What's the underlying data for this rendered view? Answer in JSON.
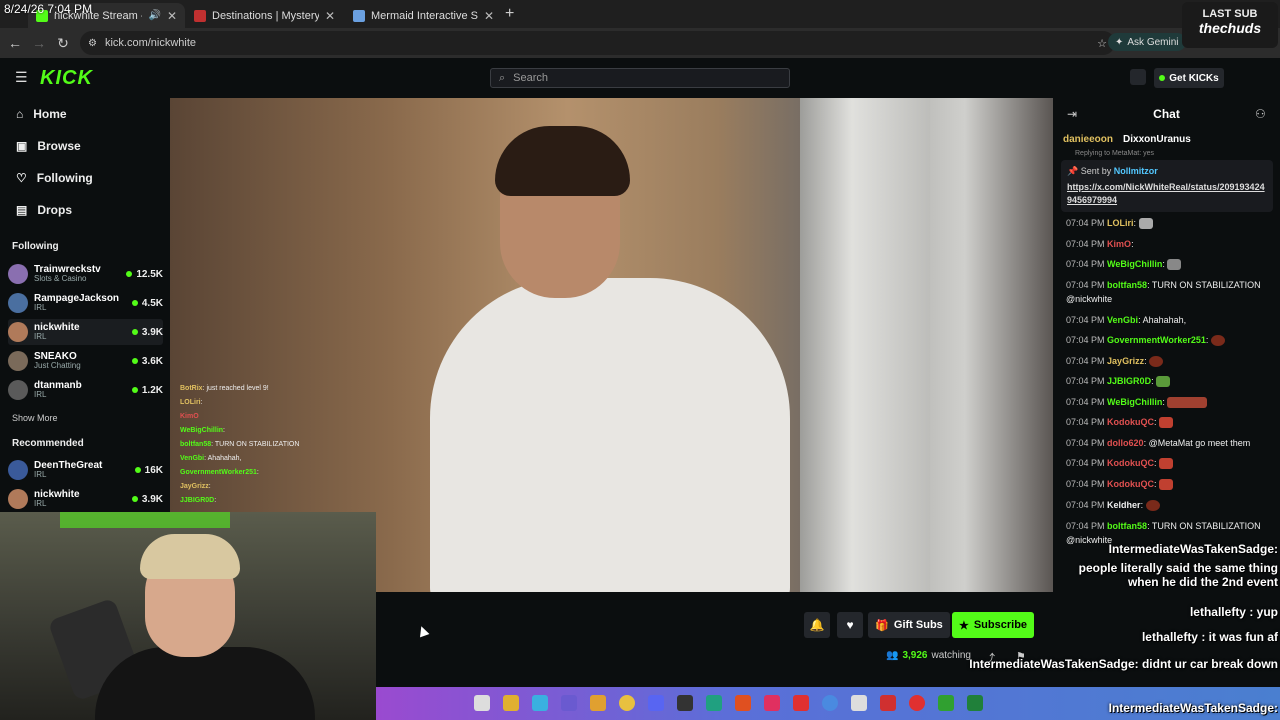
{
  "colors": {
    "accent": "#53fc18",
    "background": "#0b0e0f",
    "panel": "#24272c"
  },
  "overlay": {
    "clock": "8/24/26 7:04 PM",
    "last_sub_label": "LAST SUB",
    "last_sub_name": "thechuds"
  },
  "browser": {
    "tabs": [
      {
        "title": "nickwhite Stream - Watch L",
        "icon": "kick-favicon-icon",
        "active": true
      },
      {
        "title": "Destinations | Mystery Vacation",
        "icon": "destinations-favicon-icon",
        "active": false
      },
      {
        "title": "Mermaid Interactive Spotting M",
        "icon": "mermaid-favicon-icon",
        "active": false
      }
    ],
    "url": "kick.com/nickwhite",
    "gemini_label": "Ask Gemini"
  },
  "kick": {
    "logo": "KICK",
    "search_placeholder": "Search",
    "get_kicks_label": "Get KICKs"
  },
  "sidebar": {
    "nav": [
      {
        "label": "Home",
        "icon": "home-icon"
      },
      {
        "label": "Browse",
        "icon": "browse-icon"
      },
      {
        "label": "Following",
        "icon": "heart-icon"
      },
      {
        "label": "Drops",
        "icon": "drops-icon"
      }
    ],
    "following_heading": "Following",
    "following": [
      {
        "name": "Trainwreckstv",
        "category": "Slots & Casino",
        "viewers": "12.5K",
        "color": "#8a6fb0"
      },
      {
        "name": "RampageJackson",
        "category": "IRL",
        "viewers": "4.5K",
        "color": "#4a6fa0"
      },
      {
        "name": "nickwhite",
        "category": "IRL",
        "viewers": "3.9K",
        "color": "#b07a5a"
      },
      {
        "name": "SNEAKO",
        "category": "Just Chatting",
        "viewers": "3.6K",
        "color": "#7a6a5a"
      },
      {
        "name": "dtanmanb",
        "category": "IRL",
        "viewers": "1.2K",
        "color": "#5a5a5a"
      }
    ],
    "show_more": "Show More",
    "recommended_heading": "Recommended",
    "recommended": [
      {
        "name": "DeenTheGreat",
        "category": "IRL",
        "viewers": "16K",
        "color": "#3a5a9a"
      },
      {
        "name": "nickwhite",
        "category": "IRL",
        "viewers": "3.9K",
        "color": "#b07a5a"
      }
    ]
  },
  "player_overlay_chat": [
    {
      "user": "BotRix",
      "text": ": just reached level 9!"
    },
    {
      "user": "LOLiri",
      "text": ":"
    },
    {
      "user": "KimO",
      "text": ""
    },
    {
      "user": "WeBigChillin",
      "text": ":"
    },
    {
      "user": "boltfan58",
      "text": ": TURN ON STABILIZATION"
    },
    {
      "user": "VenGbi",
      "text": ": Ahahahah,"
    },
    {
      "user": "GovernmentWorker251",
      "text": ":"
    },
    {
      "user": "JayGrizz",
      "text": ":"
    },
    {
      "user": "JJBIGR0D",
      "text": ":"
    }
  ],
  "stream_actions": {
    "gift_subs": "Gift Subs",
    "subscribe": "Subscribe",
    "watching_count": "3,926",
    "watching_label": "watching"
  },
  "chat": {
    "title": "Chat",
    "pinned_top": [
      {
        "user": "danieeoon",
        "badge": "5"
      },
      {
        "user": "DixxonUranus",
        "badge": "5"
      }
    ],
    "replying": "Replying to MetaMat: yes",
    "pinned_by_label": "Sent by",
    "pinned_by_user": "Nollmitzor",
    "pinned_link": "https://x.com/NickWhiteReal/status/2091934249456979994",
    "messages": [
      {
        "time": "07:04 PM",
        "user": "LOLiri",
        "color": "#e0c060",
        "text": ":"
      },
      {
        "time": "07:04 PM",
        "user": "KimO",
        "color": "#e05050",
        "text": ":"
      },
      {
        "time": "07:04 PM",
        "user": "WeBigChillin",
        "color": "#53fc18",
        "text": ":"
      },
      {
        "time": "07:04 PM",
        "user": "boltfan58",
        "color": "#53fc18",
        "text": ": TURN ON STABILIZATION @nickwhite"
      },
      {
        "time": "07:04 PM",
        "user": "VenGbi",
        "color": "#53fc18",
        "text": ": Ahahahah,"
      },
      {
        "time": "07:04 PM",
        "user": "GovernmentWorker251",
        "color": "#53fc18",
        "text": ":"
      },
      {
        "time": "07:04 PM",
        "user": "JayGrizz",
        "color": "#e0c060",
        "text": ":"
      },
      {
        "time": "07:04 PM",
        "user": "JJBIGR0D",
        "color": "#53fc18",
        "text": ":"
      },
      {
        "time": "07:04 PM",
        "user": "WeBigChillin",
        "color": "#53fc18",
        "text": ":"
      },
      {
        "time": "07:04 PM",
        "user": "KodokuQC",
        "color": "#e05050",
        "text": ":"
      },
      {
        "time": "07:04 PM",
        "user": "dollo620",
        "color": "#e05050",
        "text": ": @MetaMat go meet them"
      },
      {
        "time": "07:04 PM",
        "user": "KodokuQC",
        "color": "#e05050",
        "text": ":"
      },
      {
        "time": "07:04 PM",
        "user": "KodokuQC",
        "color": "#e05050",
        "text": ":"
      },
      {
        "time": "07:04 PM",
        "user": "Keldher",
        "color": "#eeeeee",
        "text": ":"
      },
      {
        "time": "07:04 PM",
        "user": "boltfan58",
        "color": "#53fc18",
        "text": ": TURN ON STABILIZATION @nickwhite"
      }
    ]
  },
  "stream_chat_overlay": [
    {
      "user": "IntermediateWasTakenSadge",
      "text": "people literally said the same thing when he did the 2nd event"
    },
    {
      "user": "lethallefty",
      "text": "yup"
    },
    {
      "user": "lethallefty",
      "text": "it was fun af"
    },
    {
      "user": "IntermediateWasTakenSadge",
      "text": "didnt ur car break down"
    },
    {
      "user": "IntermediateWasTakenSadge",
      "text": ""
    }
  ]
}
